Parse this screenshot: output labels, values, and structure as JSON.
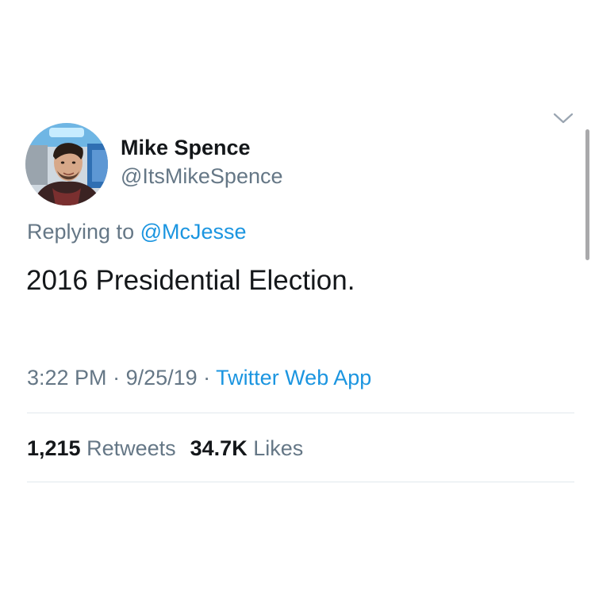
{
  "tweet": {
    "author": {
      "display_name": "Mike Spence",
      "handle": "@ItsMikeSpence",
      "avatar_icon": "user-avatar-photo"
    },
    "reply": {
      "prefix": "Replying to ",
      "mention": "@McJesse"
    },
    "text": "2016 Presidential Election.",
    "meta": {
      "time": "3:22 PM",
      "separator": " · ",
      "date": "9/25/19",
      "source": "Twitter Web App"
    },
    "stats": {
      "retweets_count": "1,215",
      "retweets_label": " Retweets",
      "likes_count": "34.7K",
      "likes_label": " Likes"
    },
    "menu_icon": "chevron-down-icon"
  },
  "colors": {
    "text_primary": "#14171a",
    "text_secondary": "#657786",
    "link": "#1b95e0",
    "divider": "#e1e8ed"
  }
}
